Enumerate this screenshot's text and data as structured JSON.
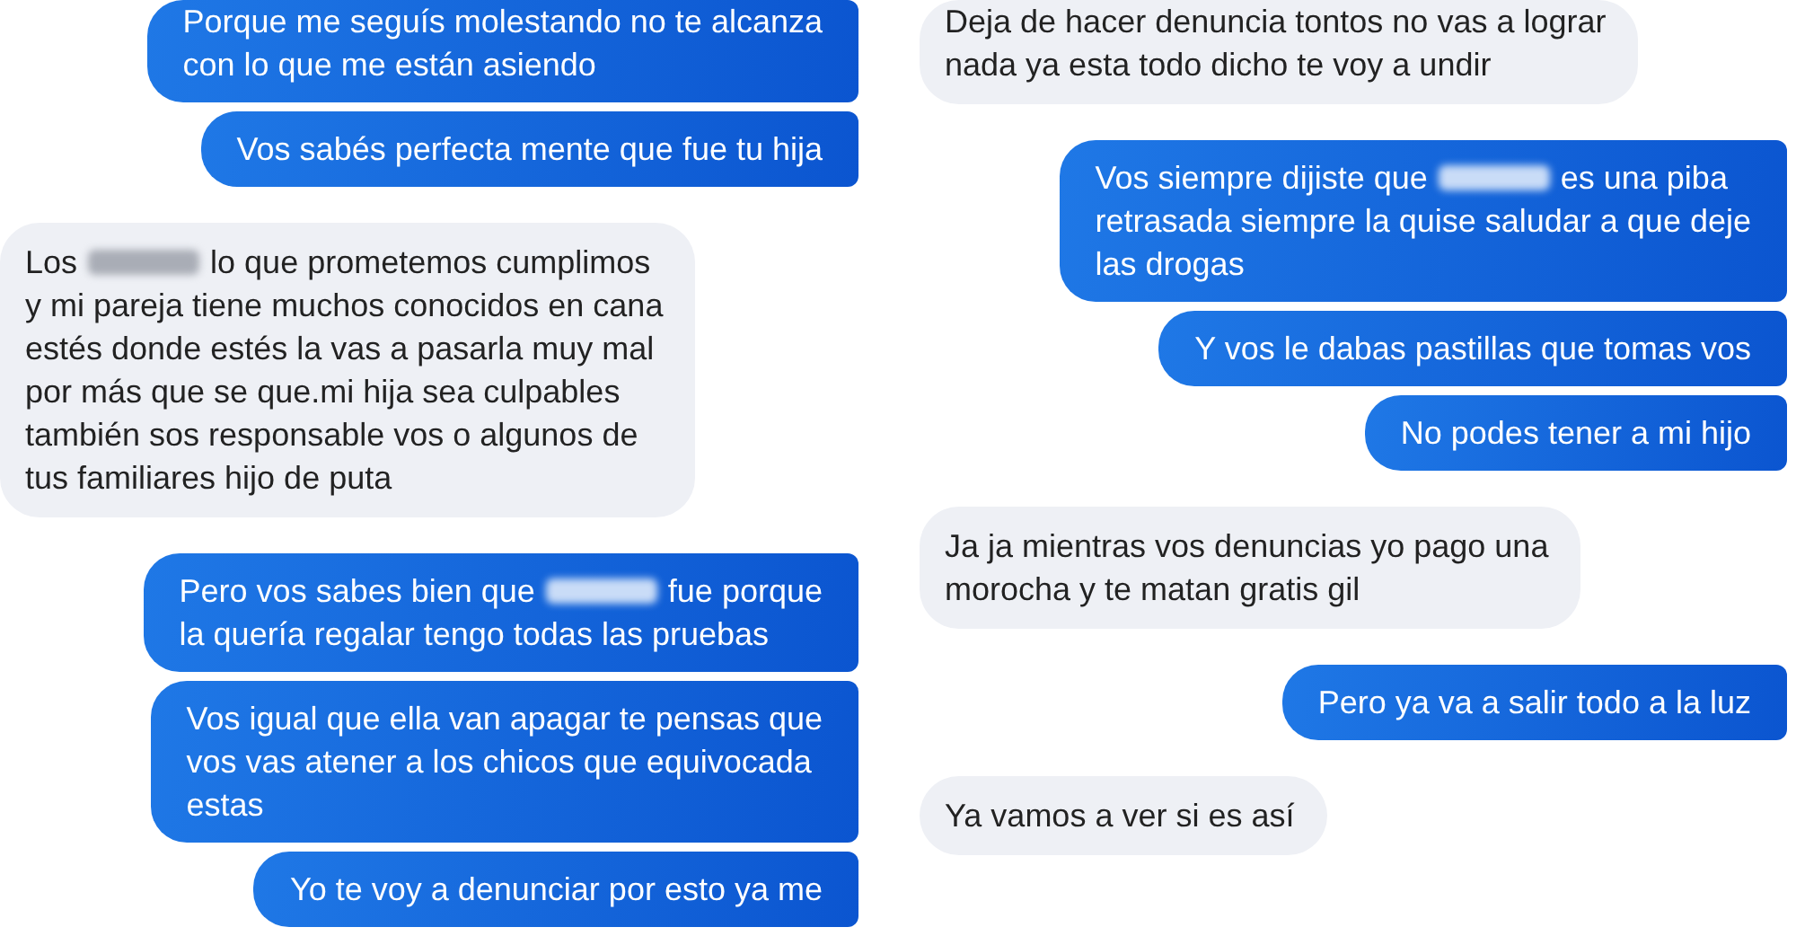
{
  "columns": [
    {
      "messages": [
        {
          "kind": "sent",
          "segments": [
            {
              "kind": "block",
              "text": "Porque me seguís molestando no te alcanza\ncon lo que me están asiendo"
            }
          ]
        },
        {
          "kind": "sent",
          "segments": [
            {
              "kind": "block",
              "text": "Vos sabés perfecta mente que fue tu hija"
            }
          ]
        },
        {
          "kind": "received",
          "segments": [
            {
              "kind": "text",
              "text": "Los"
            },
            {
              "kind": "redacted"
            },
            {
              "kind": "text",
              "text": "lo que prometemos cumplimos"
            },
            {
              "kind": "block",
              "text": "y mi pareja  tiene muchos conocidos en cana\nestés donde estés  la vas a pasarla muy mal\npor más que se que.mi hija  sea culpables\ntambién sos responsable vos  o algunos  de\ntus familiares  hijo de puta"
            }
          ]
        },
        {
          "kind": "sent",
          "segments": [
            {
              "kind": "text",
              "text": "Pero vos sabes bien que"
            },
            {
              "kind": "redacted"
            },
            {
              "kind": "text",
              "text": "fue porque"
            },
            {
              "kind": "block",
              "text": "la quería regalar tengo todas las pruebas"
            }
          ]
        },
        {
          "kind": "sent",
          "segments": [
            {
              "kind": "block",
              "text": "Vos igual que ella van apagar te pensas que\nvos vas atener a los chicos que equivocada\nestas"
            }
          ]
        },
        {
          "kind": "sent",
          "segments": [
            {
              "kind": "block",
              "text": "Yo te voy a denunciar por esto ya me"
            }
          ]
        }
      ]
    },
    {
      "messages": [
        {
          "kind": "received",
          "segments": [
            {
              "kind": "block",
              "text": "Deja de hacer denuncia  tontos no vas a lograr\nnada ya esta todo dicho  te voy a undir"
            }
          ]
        },
        {
          "kind": "sent",
          "segments": [
            {
              "kind": "text",
              "text": "Vos siempre dijiste que"
            },
            {
              "kind": "redacted"
            },
            {
              "kind": "text",
              "text": "es una piba"
            },
            {
              "kind": "block",
              "text": "retrasada siempre la quise saludar a que deje\nlas drogas"
            }
          ]
        },
        {
          "kind": "sent",
          "segments": [
            {
              "kind": "block",
              "text": "Y vos le dabas pastillas que tomas vos"
            }
          ]
        },
        {
          "kind": "sent",
          "segments": [
            {
              "kind": "block",
              "text": "No podes tener a mi hijo"
            }
          ]
        },
        {
          "kind": "received",
          "segments": [
            {
              "kind": "block",
              "text": "Ja ja mientras  vos denuncias yo pago una\nmorocha y te matan gratis gil"
            }
          ]
        },
        {
          "kind": "sent",
          "segments": [
            {
              "kind": "block",
              "text": "Pero ya va a salir todo a la luz"
            }
          ]
        },
        {
          "kind": "received",
          "segments": [
            {
              "kind": "block",
              "text": "Ya vamos a ver si es así"
            }
          ]
        }
      ]
    }
  ]
}
